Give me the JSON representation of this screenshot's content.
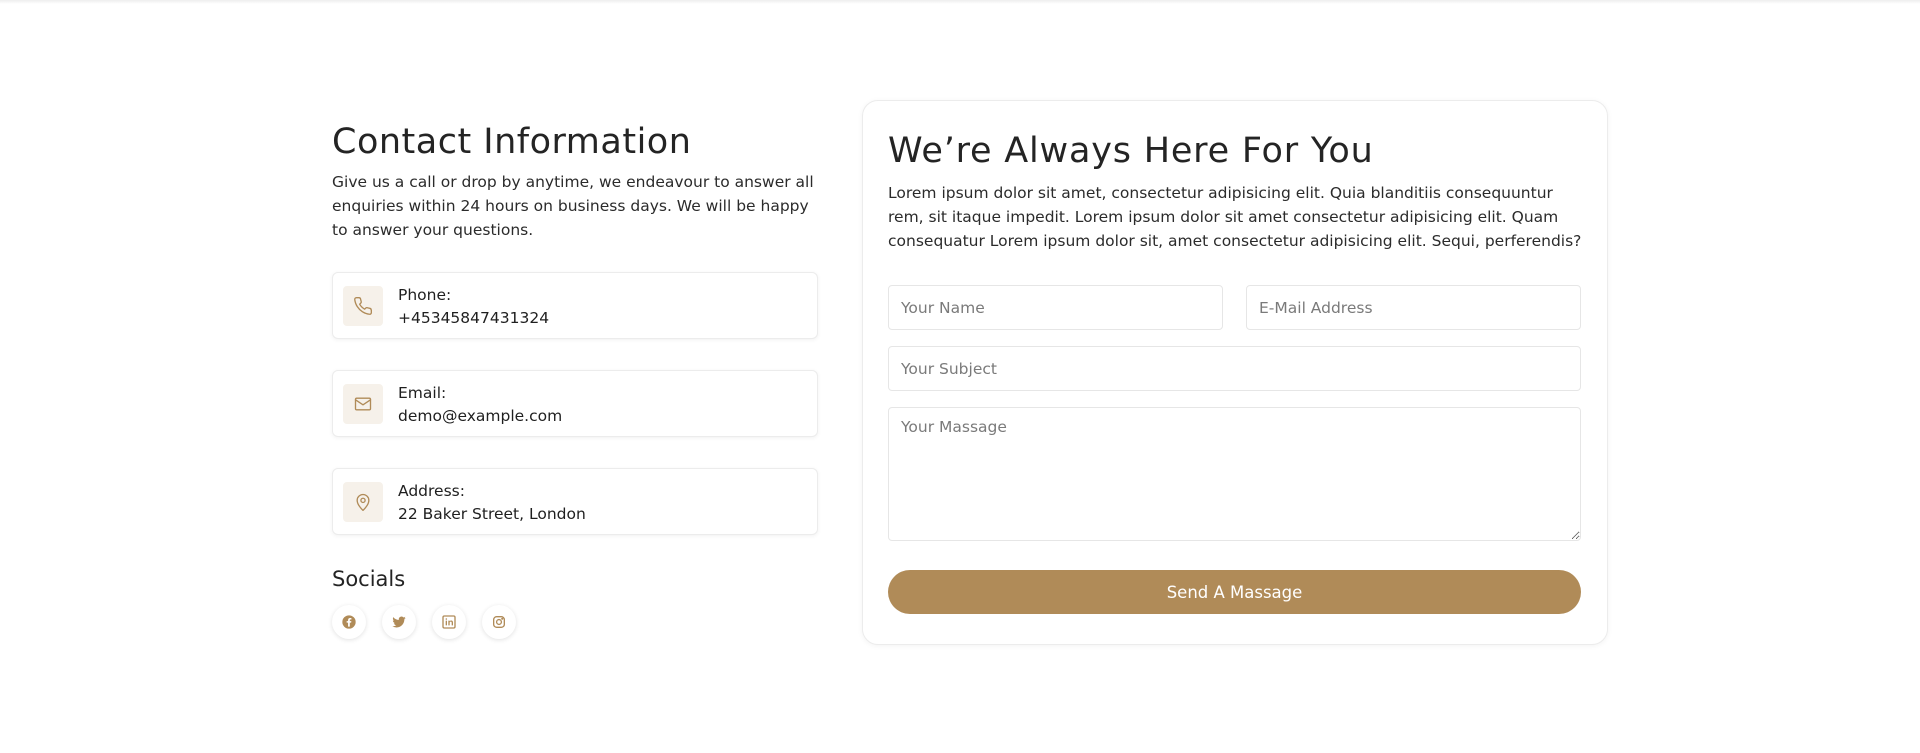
{
  "contact": {
    "title": "Contact Information",
    "intro": "Give us a call or drop by anytime, we endeavour to answer all enquiries within 24 hours on business days. We will be happy to answer your questions.",
    "cards": [
      {
        "label": "Phone:",
        "value": "+45345847431324",
        "icon": "phone-icon"
      },
      {
        "label": "Email:",
        "value": "demo@example.com",
        "icon": "mail-icon"
      },
      {
        "label": "Address:",
        "value": "22 Baker Street, London",
        "icon": "map-pin-icon"
      }
    ],
    "socials_title": "Socials",
    "socials": [
      "facebook-icon",
      "twitter-icon",
      "linkedin-icon",
      "instagram-icon"
    ],
    "icon_color": "#b08b58",
    "icon_bg": "#f6f1ea"
  },
  "form": {
    "title": "We’re Always Here For You",
    "description": "Lorem ipsum dolor sit amet, consectetur adipisicing elit. Quia blanditiis consequuntur rem, sit itaque impedit. Lorem ipsum dolor sit amet consectetur adipisicing elit. Quam consequatur Lorem ipsum dolor sit, amet consectetur adipisicing elit. Sequi, perferendis?",
    "name_placeholder": "Your Name",
    "email_placeholder": "E-Mail Address",
    "subject_placeholder": "Your Subject",
    "message_placeholder": "Your Massage",
    "submit_label": "Send A Massage",
    "accent": "#b08b58"
  }
}
